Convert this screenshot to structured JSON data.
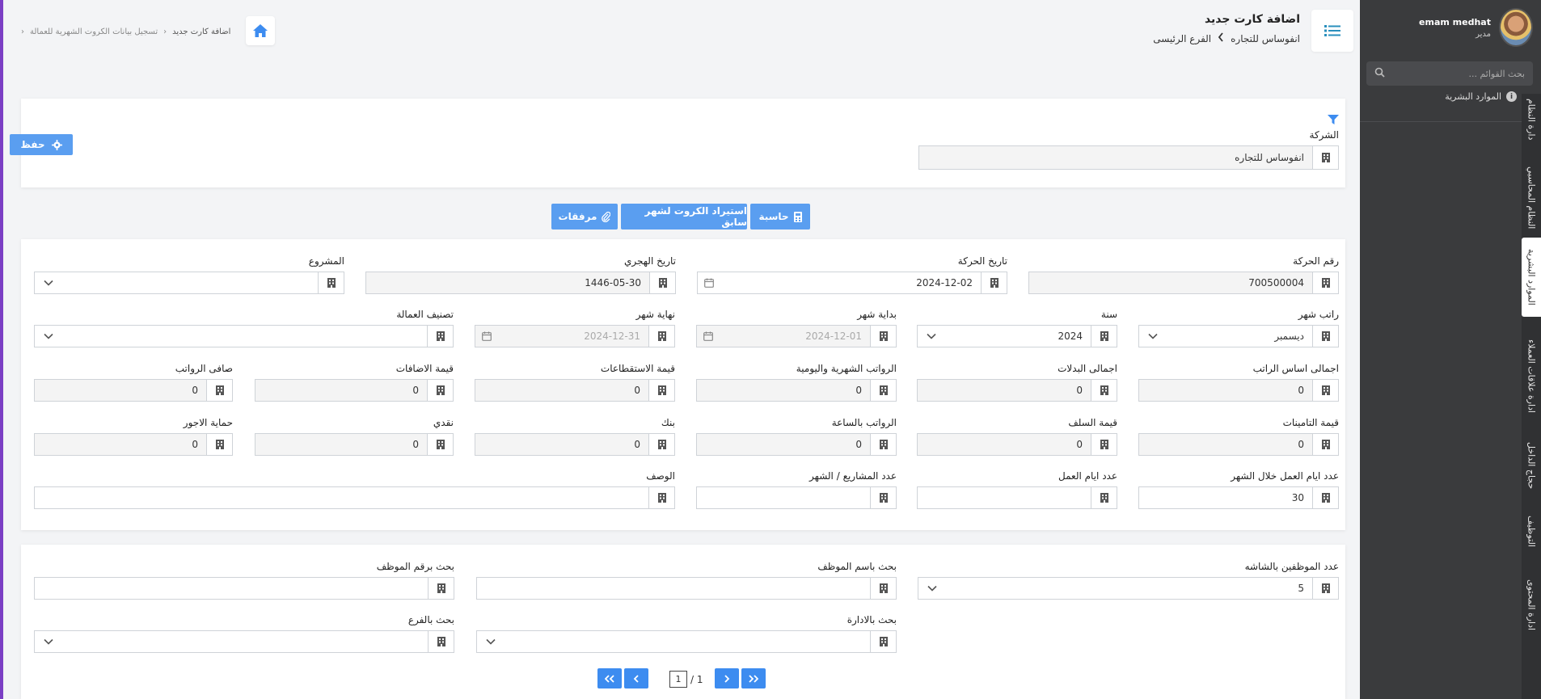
{
  "user": {
    "name": "emam medhat",
    "role": "مدير"
  },
  "sidebar": {
    "search_placeholder": "بحث القوائم ...",
    "menu_item": "الموارد البشرية",
    "tabs": [
      {
        "label": "دارة النظام"
      },
      {
        "label": "النظام المحاسبي"
      },
      {
        "label": "الموارد البشرية",
        "active": true
      },
      {
        "label": "ادارة علاقات العملاء"
      },
      {
        "label": "حجاج الداخل"
      },
      {
        "label": "التوظيف"
      },
      {
        "label": "ادارة المحتوى"
      }
    ]
  },
  "header": {
    "title": "اضافة كارت جديد",
    "company": "انفوساس للتجاره",
    "branch": "الفرع الرئيسى"
  },
  "breadcrumb": {
    "parent": "تسجيل بيانات الكروت الشهرية للعمالة",
    "current": "اضافة كارت جديد"
  },
  "save_label": "حفظ",
  "company_field": {
    "label": "الشركة",
    "value": "انفوساس للتجاره"
  },
  "actions": {
    "calculator": "حاسبة",
    "import_previous": "استيراد الكروت لشهر سابق",
    "attachments": "مرفقات"
  },
  "form": {
    "movement_number": {
      "label": "رقم الحركة",
      "value": "700500004"
    },
    "movement_date": {
      "label": "تاريخ الحركة",
      "value": "2024-12-02"
    },
    "hijri_date": {
      "label": "تاريخ الهجري",
      "value": "1446-05-30"
    },
    "project": {
      "label": "المشروع",
      "value": ""
    },
    "salary_month": {
      "label": "راتب شهر",
      "value": "ديسمبر"
    },
    "year": {
      "label": "سنة",
      "value": "2024"
    },
    "month_start": {
      "label": "بداية شهر",
      "value": "2024-12-01"
    },
    "month_end": {
      "label": "نهاية شهر",
      "value": "2024-12-31"
    },
    "labor_class": {
      "label": "تصنيف العمالة",
      "value": ""
    },
    "total_basic_salary": {
      "label": "اجمالى اساس الراتب",
      "value": "0"
    },
    "total_allowances": {
      "label": "اجمالى البدلات",
      "value": "0"
    },
    "monthly_daily_salaries": {
      "label": "الرواتب الشهرية واليومية",
      "value": "0"
    },
    "deductions_value": {
      "label": "قيمة الاستقطاعات",
      "value": "0"
    },
    "additions_value": {
      "label": "قيمة الاضافات",
      "value": "0"
    },
    "net_salaries": {
      "label": "صافى الرواتب",
      "value": "0"
    },
    "insurance_value": {
      "label": "قيمة التامينات",
      "value": "0"
    },
    "advances_value": {
      "label": "قيمة السلف",
      "value": "0"
    },
    "hourly_salaries": {
      "label": "الرواتب بالساعة",
      "value": "0"
    },
    "bank": {
      "label": "بنك",
      "value": "0"
    },
    "cash": {
      "label": "نقدي",
      "value": "0"
    },
    "wage_protection": {
      "label": "حماية الاجور",
      "value": "0"
    },
    "work_days_in_month": {
      "label": "عدد ايام العمل خلال الشهر",
      "value": "30"
    },
    "work_days": {
      "label": "عدد ايام العمل",
      "value": ""
    },
    "projects_per_month": {
      "label": "عدد المشاريع / الشهر",
      "value": ""
    },
    "description": {
      "label": "الوصف",
      "value": ""
    }
  },
  "filters": {
    "employees_on_screen": {
      "label": "عدد الموظفين بالشاشه",
      "value": "5"
    },
    "search_by_name": {
      "label": "بحث باسم الموظف",
      "value": ""
    },
    "search_by_number": {
      "label": "بحث برقم الموظف",
      "value": ""
    },
    "search_by_department": {
      "label": "بحث بالادارة",
      "value": ""
    },
    "search_by_branch": {
      "label": "بحث بالفرع",
      "value": ""
    }
  },
  "pager": {
    "current": "1",
    "total": "/ 1"
  },
  "colors": {
    "accent": "#5a9ef0",
    "sidebar_bg": "#3a3b3d",
    "left_strip": "#7b3fc4"
  }
}
